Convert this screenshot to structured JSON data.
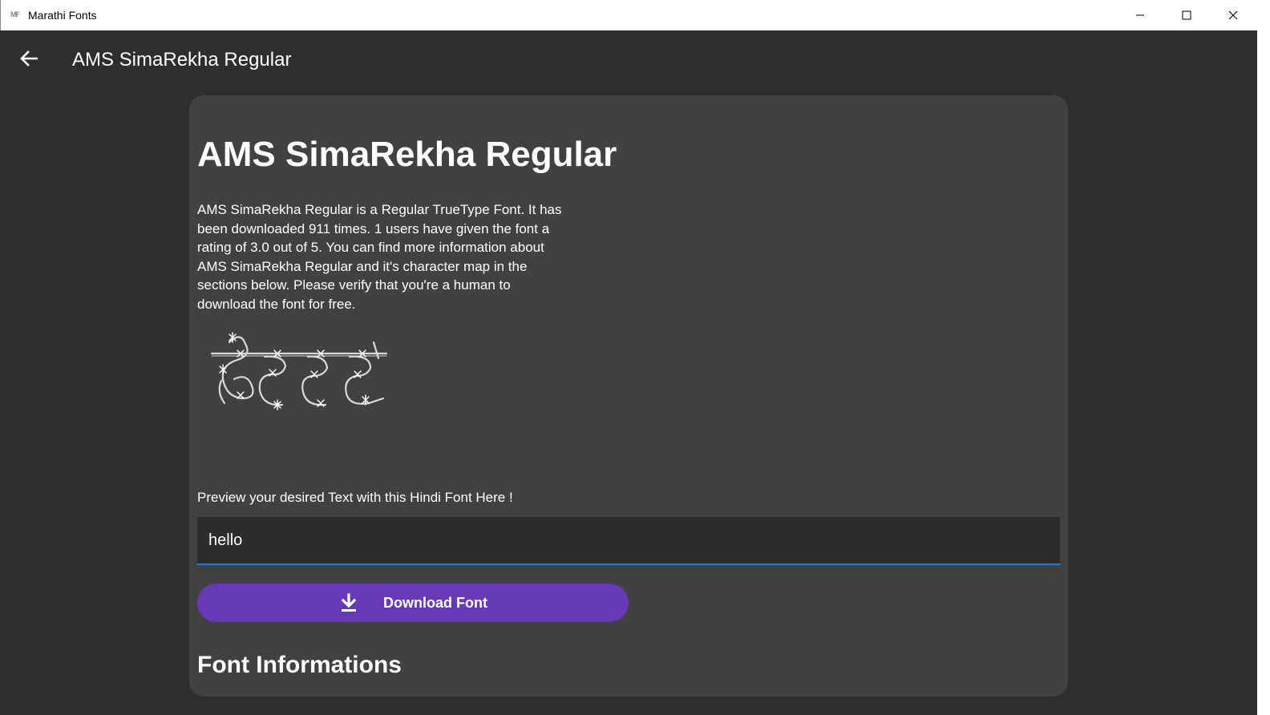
{
  "window": {
    "app_icon_text": "MF",
    "title": "Marathi Fonts"
  },
  "header": {
    "title": "AMS SimaRekha Regular"
  },
  "font": {
    "title": "AMS SimaRekha Regular",
    "description": " AMS SimaRekha Regular  is a Regular TrueType Font. It has been downloaded 911 times. 1 users have given the font a rating of 3.0 out of 5. You can find more information about AMS SimaRekha Regular and it's character map in the sections below. Please verify that you're a human to download the font for free.",
    "sample_image_icon": "devanagari-sample-glyphs"
  },
  "preview": {
    "label": "Preview your desired Text with this Hindi Font Here !",
    "value": "hello"
  },
  "download": {
    "label": "Download Font",
    "icon": "download-icon"
  },
  "section": {
    "title": "Font Informations"
  },
  "colors": {
    "background": "#2e2e2e",
    "card": "#414141",
    "accent_button": "#6739b6",
    "input_underline": "#1f78d6"
  }
}
